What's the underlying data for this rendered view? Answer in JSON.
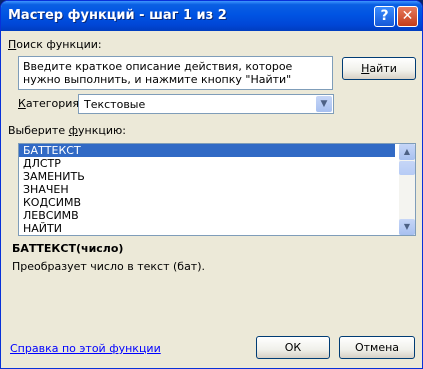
{
  "window": {
    "title": "Мастер функций - шаг 1 из 2",
    "help_glyph": "?",
    "close_glyph": "✕"
  },
  "search": {
    "label": "Поиск функции:",
    "description": "Введите краткое описание действия, которое нужно выполнить, и нажмите кнопку \"Найти\"",
    "find_button": "Найти"
  },
  "category": {
    "label": "Категория:",
    "value": "Текстовые"
  },
  "function_list": {
    "label": "Выберите функцию:",
    "items": [
      "БАТТЕКСТ",
      "ДЛСТР",
      "ЗАМЕНИТЬ",
      "ЗНАЧЕН",
      "КОДСИМВ",
      "ЛЕВСИМВ",
      "НАЙТИ"
    ],
    "selected_index": 0
  },
  "selected_function": {
    "signature": "БАТТЕКСТ(число)",
    "description": "Преобразует число в текст (бат)."
  },
  "footer": {
    "help_link": "Справка по этой функции",
    "ok_button": "ОК",
    "cancel_button": "Отмена"
  }
}
